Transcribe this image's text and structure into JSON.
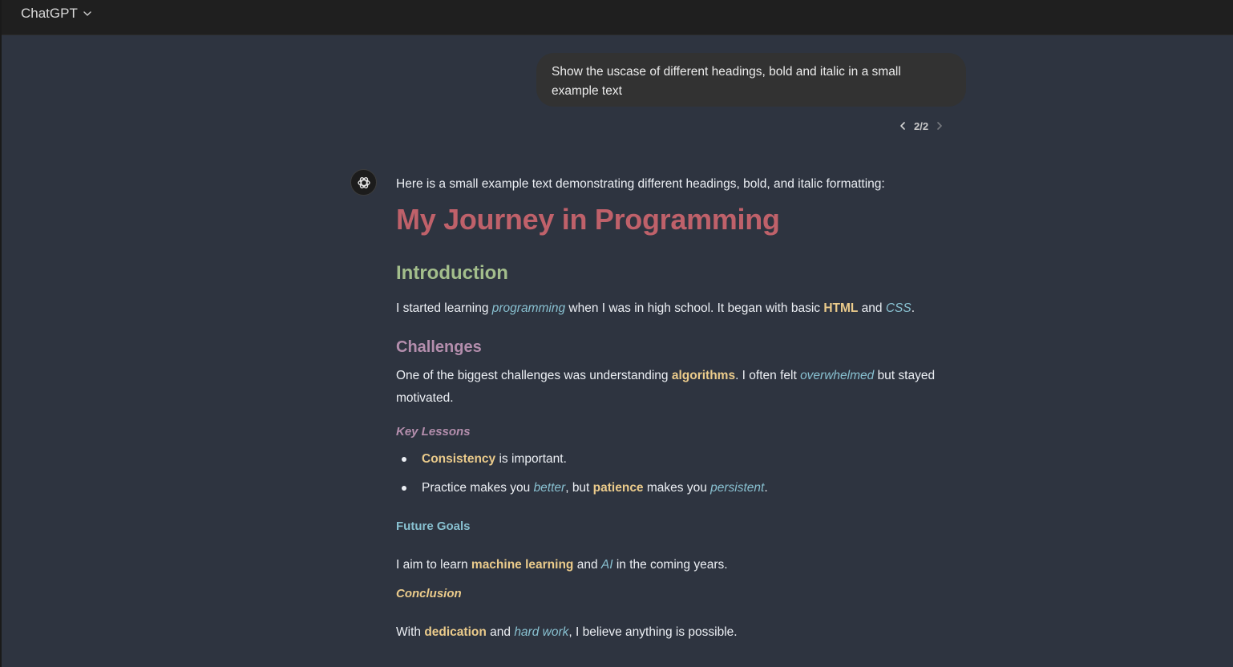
{
  "header": {
    "model_name": "ChatGPT"
  },
  "user_message": {
    "text": "Show the uscase of different headings, bold and italic in a small example text"
  },
  "pager": {
    "current": "2/2"
  },
  "assistant": {
    "intro": "Here is a small example text demonstrating different headings, bold, and italic formatting:",
    "h1": "My Journey in Programming",
    "h2": "Introduction",
    "p1": {
      "t1": "I started learning ",
      "i1": "programming",
      "t2": " when I was in high school. It began with basic ",
      "b1": "HTML",
      "t3": " and ",
      "i2": "CSS",
      "t4": "."
    },
    "h3": "Challenges",
    "p2": {
      "t1": "One of the biggest challenges was understanding ",
      "b1": "algorithms",
      "t2": ". I often felt ",
      "i1": "overwhelmed",
      "t3": " but stayed motivated."
    },
    "h4": "Key Lessons",
    "list": [
      {
        "b1": "Consistency",
        "t1": " is important."
      },
      {
        "t1": "Practice makes you ",
        "i1": "better",
        "t2": ", but ",
        "b1": "patience",
        "t3": " makes you ",
        "i2": "persistent",
        "t4": "."
      }
    ],
    "h5": "Future Goals",
    "p3": {
      "t1": "I aim to learn ",
      "b1": "machine learning",
      "t2": " and ",
      "i1": "AI",
      "t3": " in the coming years."
    },
    "h6": "Conclusion",
    "p4": {
      "t1": "With ",
      "b1": "dedication",
      "t2": " and ",
      "i1": "hard work",
      "t3": ", I believe anything is possible."
    }
  },
  "colors": {
    "background": "#2e3440",
    "topbar": "#1f1f1f",
    "user_bubble": "#323232",
    "h1": "#bf616a",
    "h2": "#a3be8c",
    "h3": "#b48ead",
    "h5": "#88c0d0",
    "bold": "#ebcb8b",
    "italic": "#88c0d0"
  },
  "icons": {
    "assistant_avatar": "openai-logo-icon",
    "model_dropdown": "chevron-down-icon",
    "prev": "chevron-left-icon",
    "next": "chevron-right-icon"
  }
}
